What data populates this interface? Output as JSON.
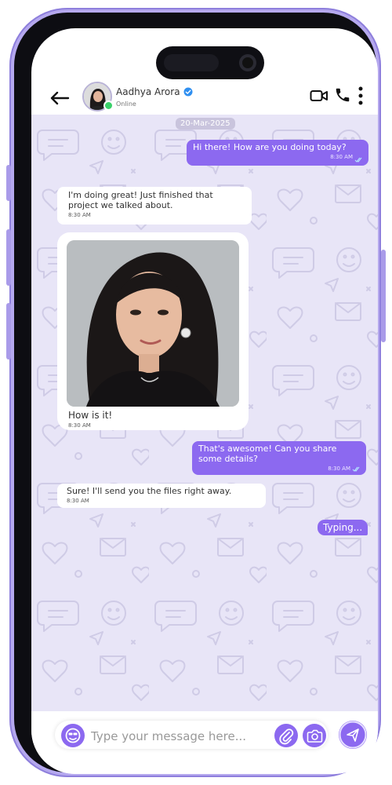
{
  "header": {
    "contact_name": "Aadhya Arora",
    "status": "Online",
    "icons": [
      "back-arrow-icon",
      "verified-icon",
      "video-call-icon",
      "phone-call-icon",
      "more-vertical-icon"
    ]
  },
  "chat": {
    "date": "20-Mar-2025",
    "messages": [
      {
        "dir": "out",
        "text": "Hi there! How are you doing today?",
        "time": "8:30 AM"
      },
      {
        "dir": "in",
        "text": "I'm doing great! Just finished that project we talked about.",
        "time": "8:30 AM"
      },
      {
        "dir": "in",
        "text": "How is it!",
        "time": "8:30 AM",
        "image": true
      },
      {
        "dir": "out",
        "text": "That's awesome! Can you share some details?",
        "time": "8:30 AM"
      },
      {
        "dir": "in",
        "text": "Sure! I'll send you the files right away.",
        "time": "8:30 AM"
      }
    ],
    "typing_label": "Typing..."
  },
  "composer": {
    "placeholder": "Type your message here...",
    "icons": [
      "emoji-icon",
      "attach-icon",
      "camera-icon",
      "send-icon"
    ]
  },
  "colors": {
    "accent": "#8c69f0",
    "chat_bg": "#e8e5f7",
    "frame": "#b5a8ee"
  }
}
